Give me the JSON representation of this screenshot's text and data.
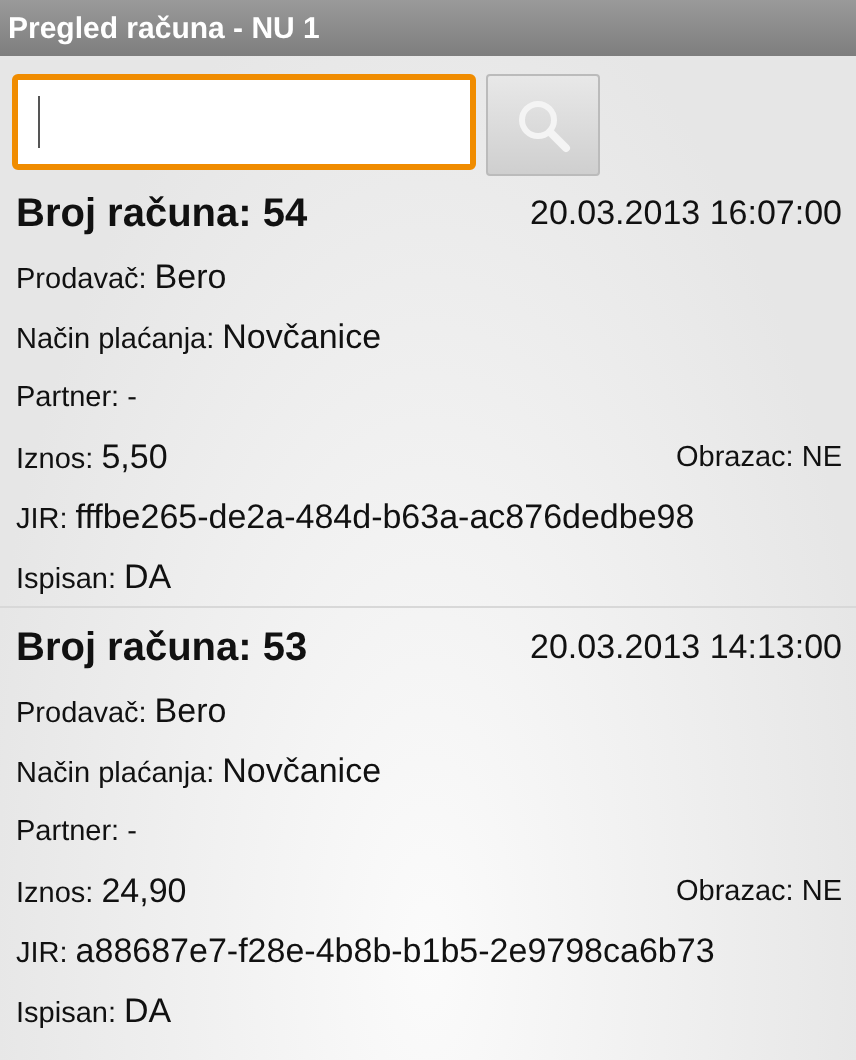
{
  "window": {
    "title": "Pregled računa - NU 1"
  },
  "search": {
    "focused": true
  },
  "records": [
    {
      "title": "Broj računa: 54",
      "datetime": "20.03.2013 16:07:00",
      "fields": [
        {
          "label": "Prodavač:",
          "value": "Bero"
        },
        {
          "label": "Način plaćanja:",
          "value": "Novčanice"
        },
        {
          "label": "Partner: -"
        },
        {
          "label": "Iznos:",
          "value": "5,50",
          "aside": "Obrazac: NE"
        },
        {
          "label": "JIR:",
          "value": "fffbe265-de2a-484d-b63a-ac876dedbe98"
        },
        {
          "label": "Ispisan:",
          "value": "DA"
        }
      ]
    },
    {
      "title": "Broj računa: 53",
      "datetime": "20.03.2013 14:13:00",
      "fields": [
        {
          "label": "Prodavač:",
          "value": "Bero"
        },
        {
          "label": "Način plaćanja:",
          "value": "Novčanice"
        },
        {
          "label": "Partner: -"
        },
        {
          "label": "Iznos:",
          "value": "24,90",
          "aside": "Obrazac: NE"
        },
        {
          "label": "JIR:",
          "value": "a88687e7-f28e-4b8b-b1b5-2e9798ca6b73"
        },
        {
          "label": "Ispisan:",
          "value": "DA"
        }
      ]
    }
  ]
}
